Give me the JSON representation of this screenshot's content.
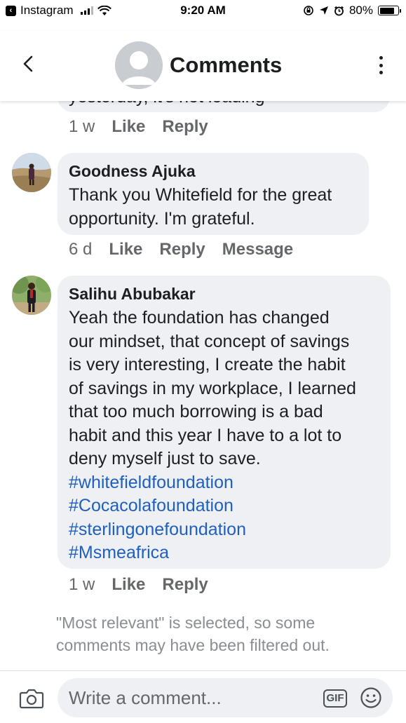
{
  "status_bar": {
    "back_app": "Instagram",
    "time": "9:20 AM",
    "battery": "80%"
  },
  "header": {
    "title": "Comments"
  },
  "partial_comment": {
    "text_fragment": "yesterday, it's not loading",
    "time": "1 w",
    "like_label": "Like",
    "reply_label": "Reply"
  },
  "comments": [
    {
      "name": "Goodness Ajuka",
      "text_lines": [
        "Thank you Whitefield for the great",
        "opportunity. I'm grateful."
      ],
      "time": "6 d",
      "like_label": "Like",
      "reply_label": "Reply",
      "message_label": "Message"
    },
    {
      "name": "Salihu Abubakar",
      "text_lines": [
        "Yeah the foundation has changed",
        "our mindset, that concept of savings",
        "is very interesting, I create the habit",
        "of savings in my workplace, I learned",
        "that too much borrowing is a bad",
        "habit and this year I have to a lot to",
        "deny myself just to save."
      ],
      "hashtags": [
        "#whitefieldfoundation",
        "#Cocacolafoundation",
        "#sterlingonefoundation",
        "#Msmeafrica"
      ],
      "time": "1 w",
      "like_label": "Like",
      "reply_label": "Reply"
    }
  ],
  "notice": "\"Most relevant\" is selected, so some comments may have been filtered out.",
  "composer": {
    "placeholder": "Write a comment...",
    "gif_label": "GIF"
  },
  "colors": {
    "bubble": "#eef0f3",
    "hashtag": "#1f5fbf",
    "meta": "#65676b"
  }
}
